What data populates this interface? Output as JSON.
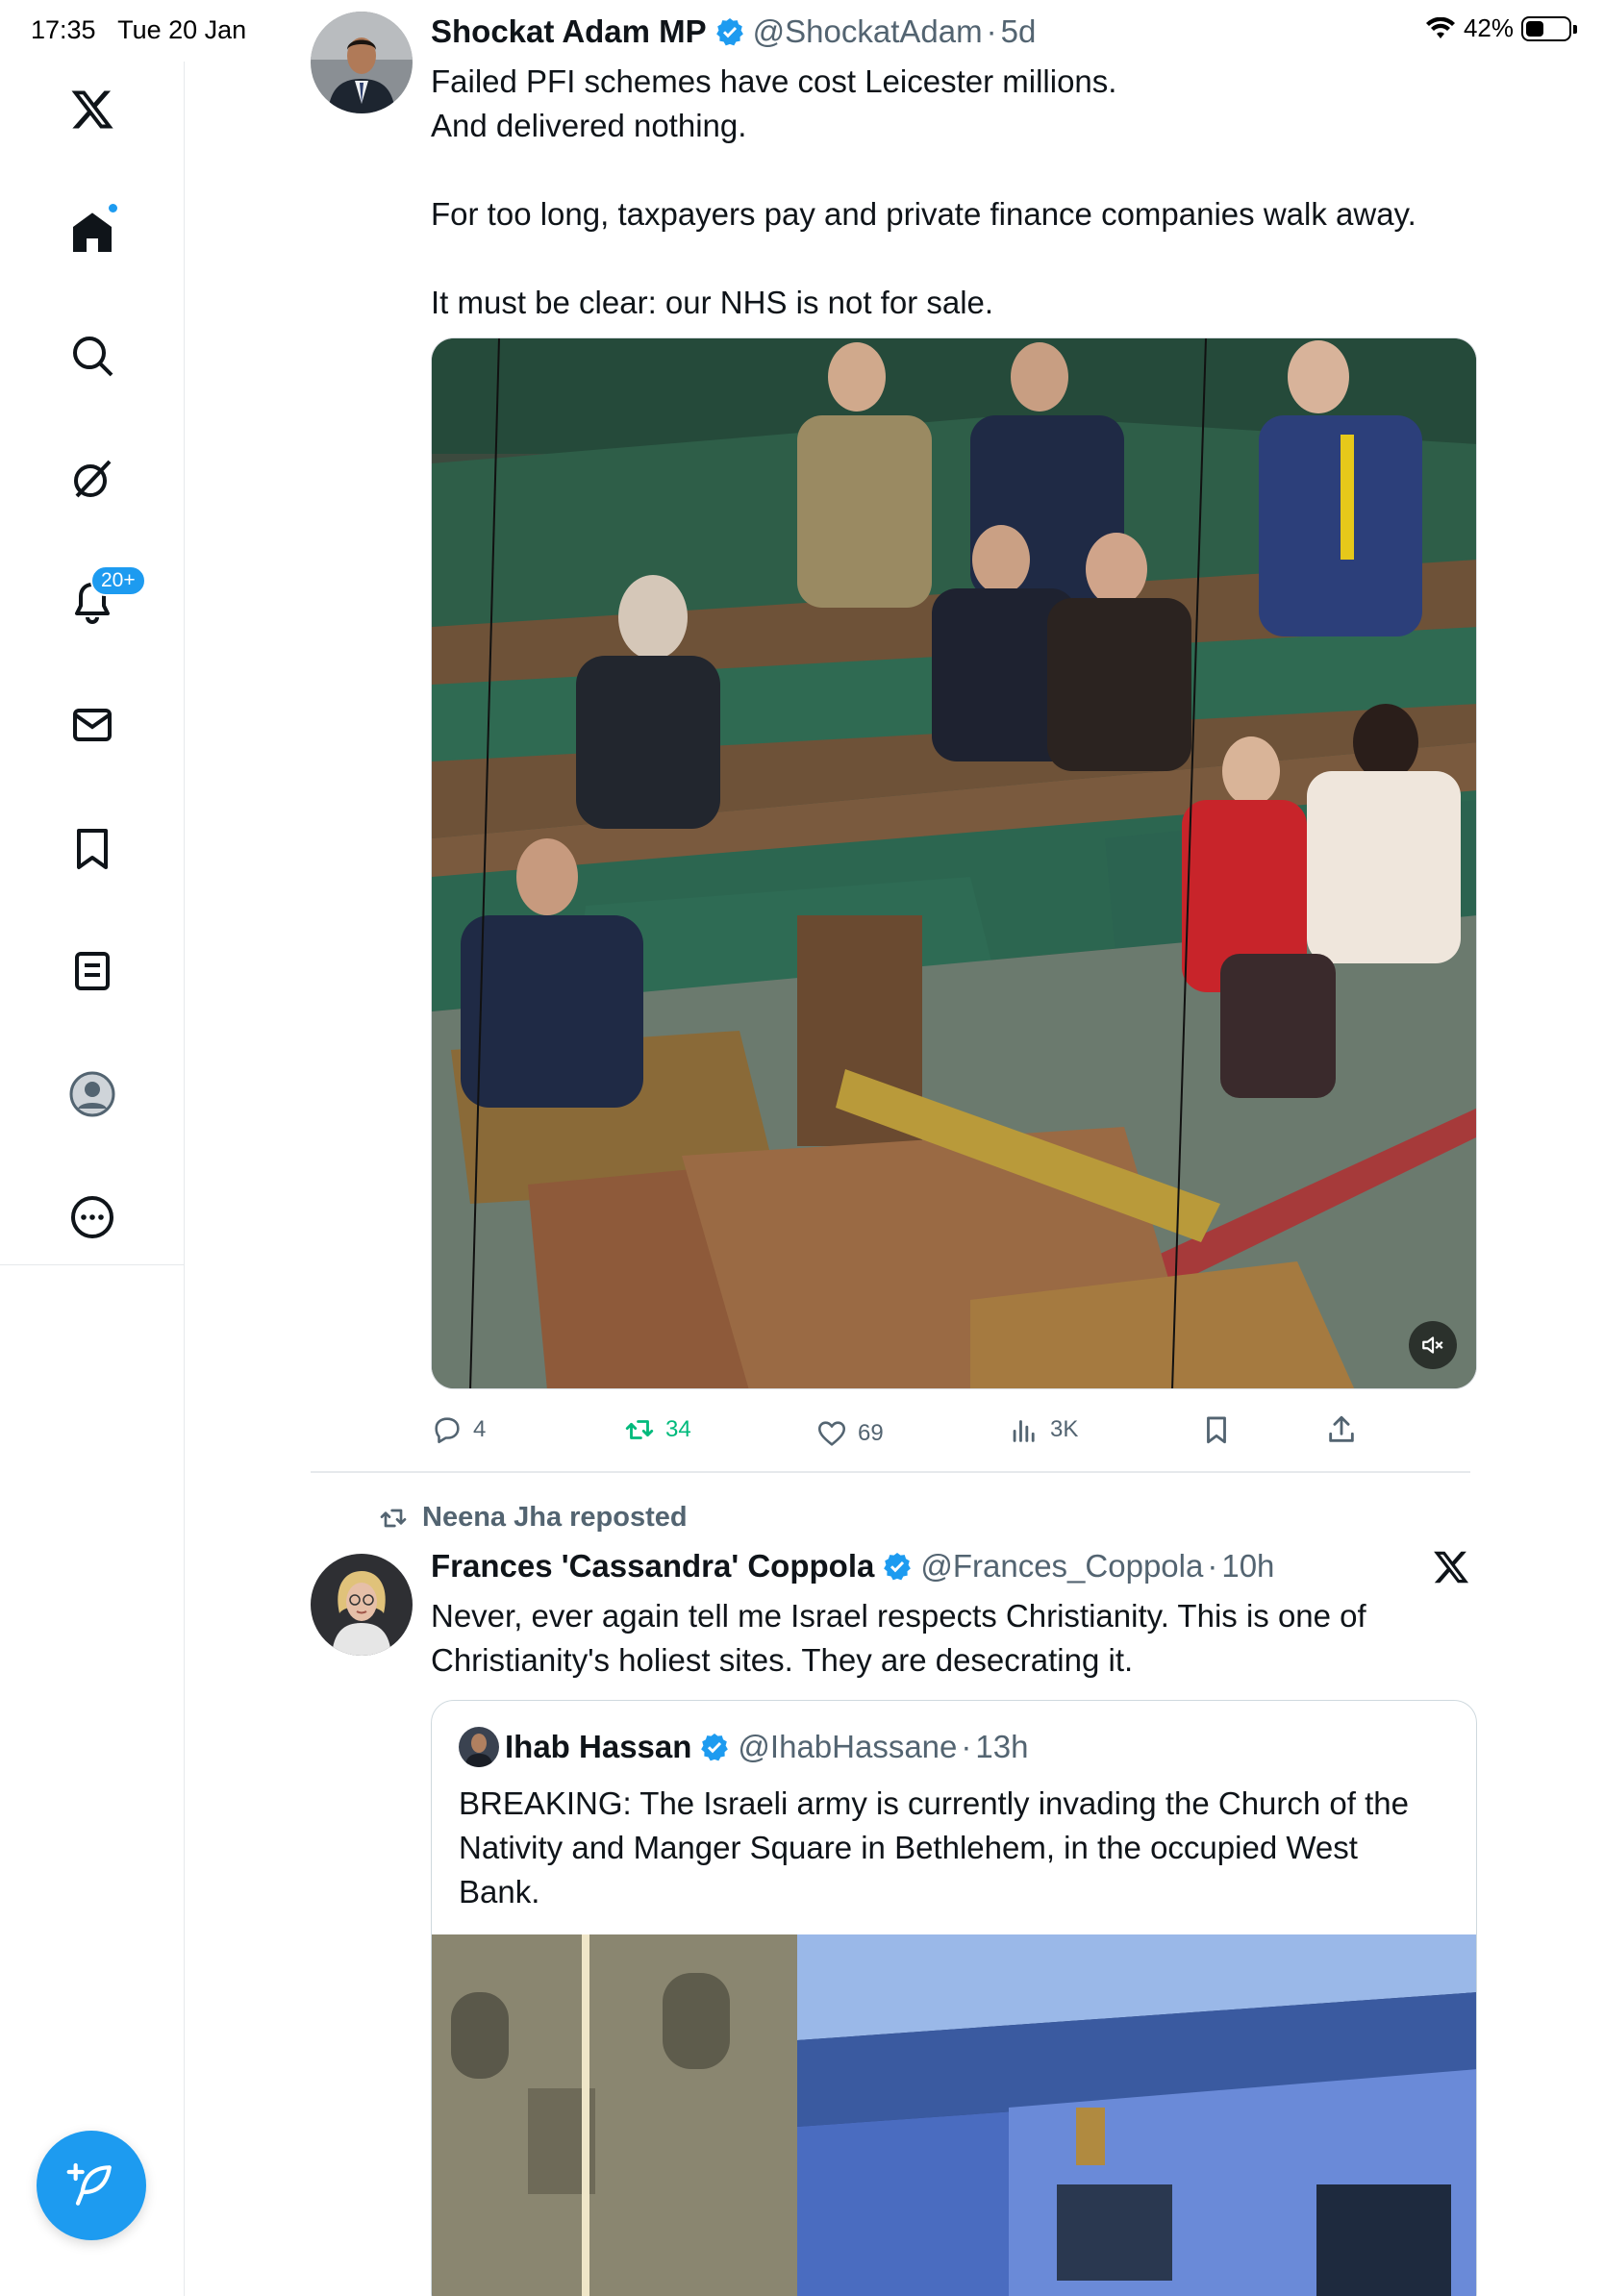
{
  "status_bar": {
    "time": "17:35",
    "date": "Tue 20 Jan",
    "battery": "42%",
    "battery_level": 0.42
  },
  "sidebar": {
    "items": [
      {
        "name": "x-logo"
      },
      {
        "name": "home"
      },
      {
        "name": "search"
      },
      {
        "name": "grok"
      },
      {
        "name": "notifications",
        "badge": "20+"
      },
      {
        "name": "messages"
      },
      {
        "name": "bookmarks"
      },
      {
        "name": "lists"
      },
      {
        "name": "profile"
      },
      {
        "name": "more"
      }
    ],
    "accent": "#1d9bf0"
  },
  "tweets": [
    {
      "display_name": "Shockat Adam MP",
      "handle": "@ShockatAdam",
      "time": "5d",
      "text_lines": [
        "Failed PFI schemes have cost Leicester millions.",
        "And delivered nothing.",
        "",
        "For too long, taxpayers pay and private finance companies walk away.",
        "",
        "It must be clear: our NHS is not for sale."
      ],
      "stats": {
        "replies": "4",
        "reposts": "34",
        "likes": "69",
        "views": "3K"
      },
      "repost_color": "#00ba7c"
    },
    {
      "repost_by": "Neena Jha reposted",
      "display_name": "Frances 'Cassandra' Coppola",
      "handle": "@Frances_Coppola",
      "time": "10h",
      "text_lines": [
        "Never, ever again tell me Israel respects Christianity. This is one of",
        "Christianity's holiest sites. They are desecrating it."
      ],
      "quote": {
        "display_name": "Ihab Hassan",
        "handle": "@IhabHassane",
        "time": "13h",
        "text_lines": [
          "BREAKING: The Israeli army is currently invading the Church of the",
          "Nativity and Manger Square in Bethlehem, in the occupied West",
          "Bank."
        ]
      }
    }
  ]
}
